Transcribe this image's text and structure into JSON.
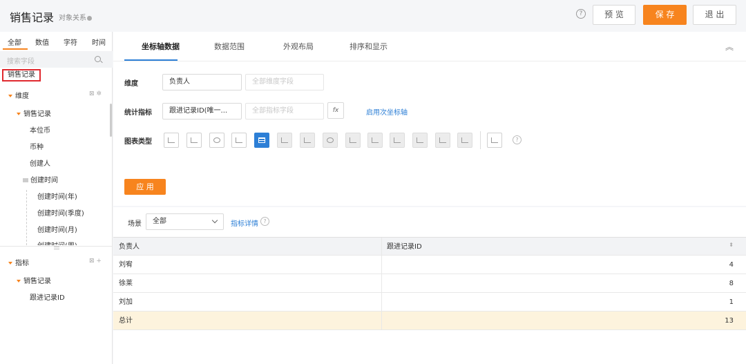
{
  "header": {
    "title": "销售记录",
    "subtitle": "对象关系",
    "help": "?",
    "preview": "预 览",
    "save": "保 存",
    "exit": "退 出"
  },
  "left": {
    "tabs": [
      "全部",
      "数值",
      "字符",
      "时间"
    ],
    "search_placeholder": "搜索字段",
    "object": "销售记录",
    "dimension_label": "维度",
    "dimension_tools": "⊠ ✲",
    "dimension_object": "销售记录",
    "dim_fields": [
      "本位币",
      "币种",
      "创建人"
    ],
    "time_group": "创建时间",
    "time_fields": [
      "创建时间(年)",
      "创建时间(季度)",
      "创建时间(月)",
      "创建时间(周)"
    ],
    "metric_label": "指标",
    "metric_tools": "⊠ +",
    "metric_object": "销售记录",
    "metric_fields": [
      "跟进记录ID"
    ]
  },
  "config": {
    "tabs": [
      "坐标轴数据",
      "数据范围",
      "外观布局",
      "排序和显示"
    ],
    "collapse": "︽",
    "dimension_label": "维度",
    "dimension_value": "负责人",
    "dimension_placeholder": "全部维度字段",
    "metric_label": "统计指标",
    "metric_value": "跟进记录ID(唯一...",
    "metric_placeholder": "全部指标字段",
    "fx": "fx",
    "secondary_axis": "启用次坐标轴",
    "chart_type_label": "图表类型",
    "help": "?",
    "apply": "应 用"
  },
  "bottom": {
    "scene_label": "场景",
    "scene_value": "全部",
    "metric_detail": "指标详情",
    "help": "?",
    "table": {
      "headers": [
        "负责人",
        "跟进记录ID"
      ],
      "sort": "⬍",
      "rows": [
        {
          "name": "刘宥",
          "value": "4"
        },
        {
          "name": "徐莱",
          "value": "8"
        },
        {
          "name": "刘加",
          "value": "1"
        }
      ],
      "total": {
        "name": "总计",
        "value": "13"
      }
    }
  }
}
